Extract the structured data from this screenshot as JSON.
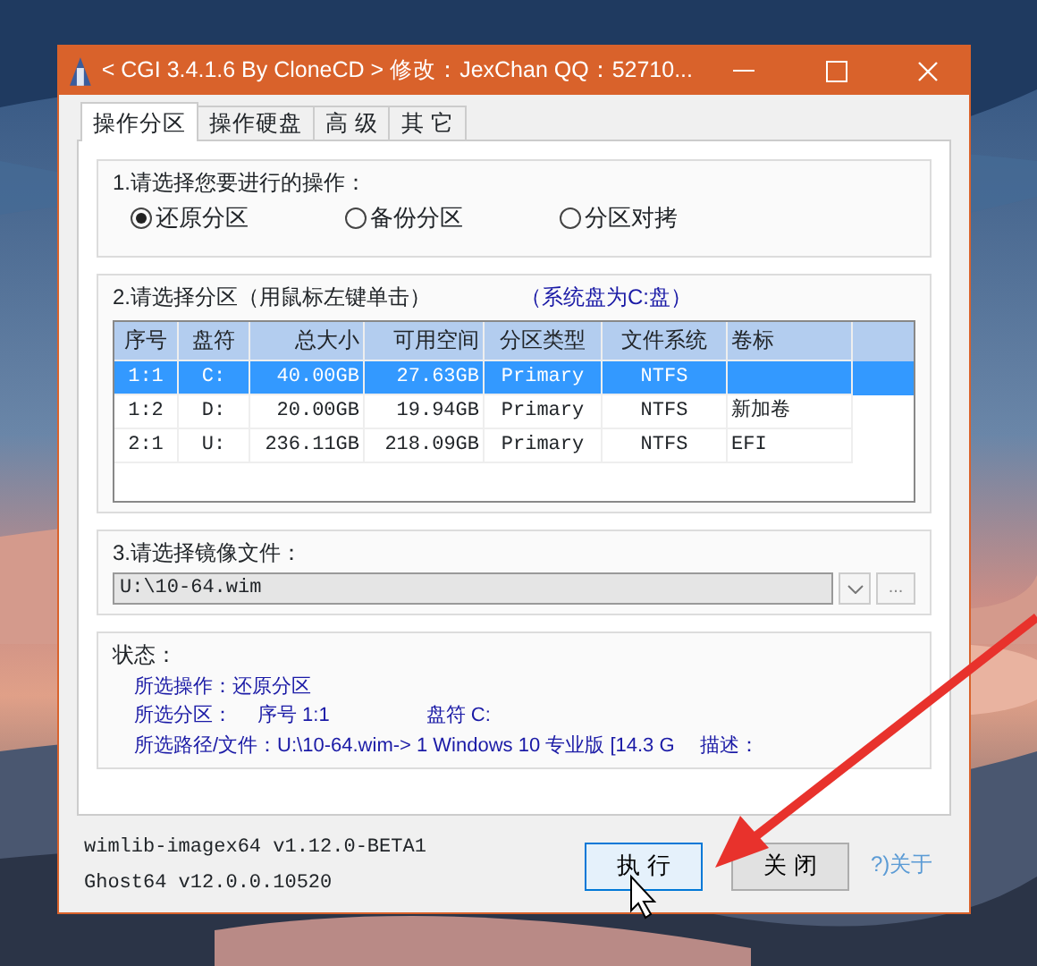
{
  "window": {
    "title": "< CGI 3.4.1.6 By CloneCD > 修改：JexChan  QQ：52710..."
  },
  "tabs": [
    {
      "label": "操作分区",
      "selected": true
    },
    {
      "label": "操作硬盘",
      "selected": false
    },
    {
      "label": "高 级",
      "selected": false
    },
    {
      "label": "其 它",
      "selected": false
    }
  ],
  "operation": {
    "label": "1.请选择您要进行的操作：",
    "options": [
      {
        "label": "还原分区",
        "selected": true
      },
      {
        "label": "备份分区",
        "selected": false
      },
      {
        "label": "分区对拷",
        "selected": false
      }
    ]
  },
  "partition": {
    "label": "2.请选择分区（用鼠标左键单击）",
    "note": "（系统盘为C:盘）",
    "table": {
      "columns": [
        "序号",
        "盘符",
        "总大小",
        "可用空间",
        "分区类型",
        "文件系统",
        "卷标"
      ],
      "rows": [
        {
          "cells": [
            "1:1",
            "C:",
            "40.00GB",
            "27.63GB",
            "Primary",
            "NTFS",
            ""
          ],
          "selected": true
        },
        {
          "cells": [
            "1:2",
            "D:",
            "20.00GB",
            "19.94GB",
            "Primary",
            "NTFS",
            "新加卷"
          ],
          "selected": false
        },
        {
          "cells": [
            "2:1",
            "U:",
            "236.11GB",
            "218.09GB",
            "Primary",
            "NTFS",
            "EFI"
          ],
          "selected": false
        }
      ]
    }
  },
  "image_file": {
    "label": "3.请选择镜像文件：",
    "value": "U:\\10-64.wim",
    "browse": "..."
  },
  "status": {
    "label": "状态：",
    "lines": [
      [
        "所选操作：还原分区"
      ],
      [
        "所选分区：",
        "序号 1:1",
        "盘符 C:"
      ],
      [
        "所选路径/文件：U:\\10-64.wim->  1  Windows 10 专业版 [14.3 G",
        "描述："
      ]
    ]
  },
  "versions": [
    "wimlib-imagex64 v1.12.0-BETA1",
    "Ghost64 v12.0.0.10520"
  ],
  "buttons": [
    {
      "label": "执 行",
      "focused": true
    },
    {
      "label": "关 闭",
      "focused": false
    }
  ],
  "about": "?)关于"
}
